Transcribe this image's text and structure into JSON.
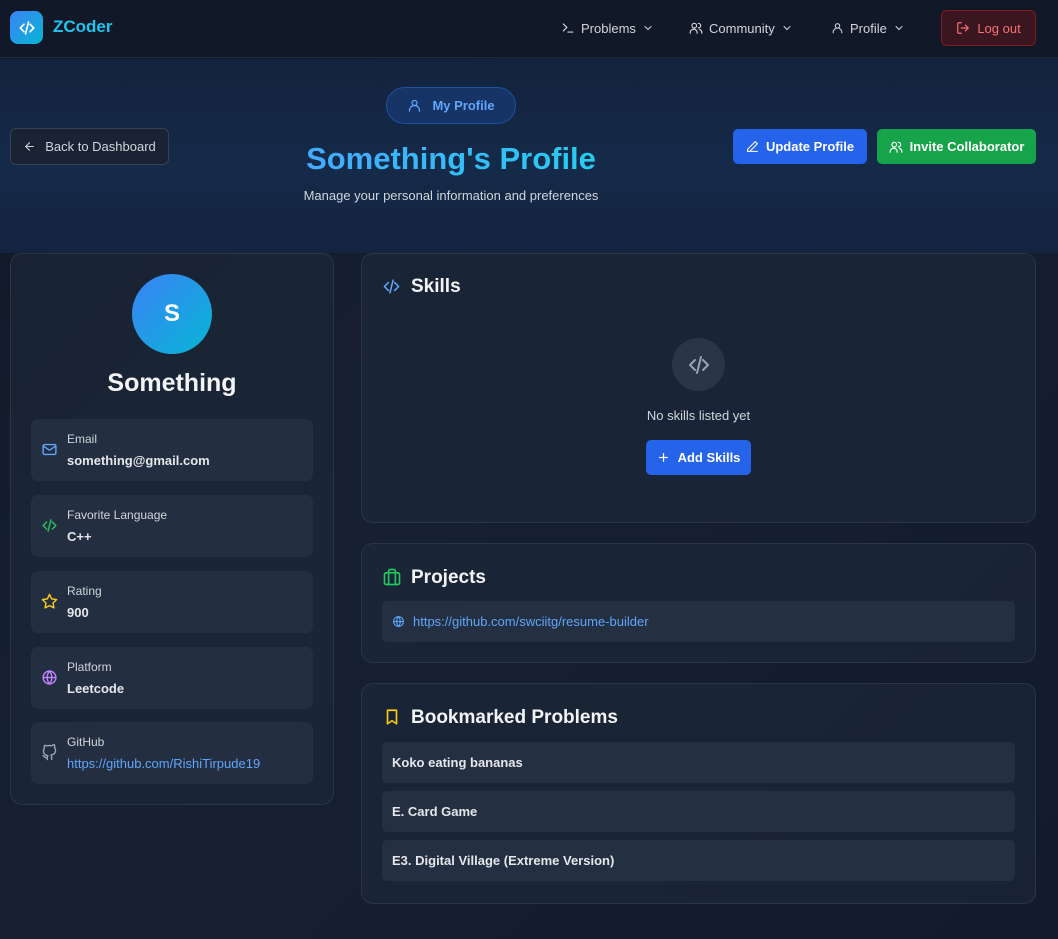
{
  "app": {
    "name": "ZCoder"
  },
  "nav": {
    "items": [
      {
        "label": "Problems",
        "icon": "terminal-icon"
      },
      {
        "label": "Community",
        "icon": "users-icon"
      },
      {
        "label": "Profile",
        "icon": "user-icon"
      }
    ],
    "logout_label": "Log out"
  },
  "hero": {
    "back_label": "Back to Dashboard",
    "pill_label": "My Profile",
    "title": "Something's Profile",
    "subtitle": "Manage your personal information and preferences",
    "update_label": "Update Profile",
    "invite_label": "Invite Collaborator"
  },
  "profile": {
    "initial": "S",
    "name": "Something",
    "fields": [
      {
        "label": "Email",
        "value": "something@gmail.com",
        "icon": "mail-icon"
      },
      {
        "label": "Favorite Language",
        "value": "C++",
        "icon": "code-icon"
      },
      {
        "label": "Rating",
        "value": "900",
        "icon": "star-icon"
      },
      {
        "label": "Platform",
        "value": "Leetcode",
        "icon": "globe-icon"
      },
      {
        "label": "GitHub",
        "value": "https://github.com/RishiTirpude19",
        "icon": "github-icon"
      }
    ]
  },
  "skills": {
    "title": "Skills",
    "empty_text": "No skills listed yet",
    "add_label": "Add Skills"
  },
  "projects": {
    "title": "Projects",
    "items": [
      "https://github.com/swciitg/resume-builder"
    ]
  },
  "bookmarks": {
    "title": "Bookmarked Problems",
    "items": [
      "Koko eating bananas",
      "E. Card Game",
      "E3. Digital Village (Extreme Version)"
    ]
  },
  "colors": {
    "accent_blue": "#2563eb",
    "accent_green": "#16a34a",
    "logout_red": "#f87171",
    "link_blue": "#60a5fa"
  }
}
